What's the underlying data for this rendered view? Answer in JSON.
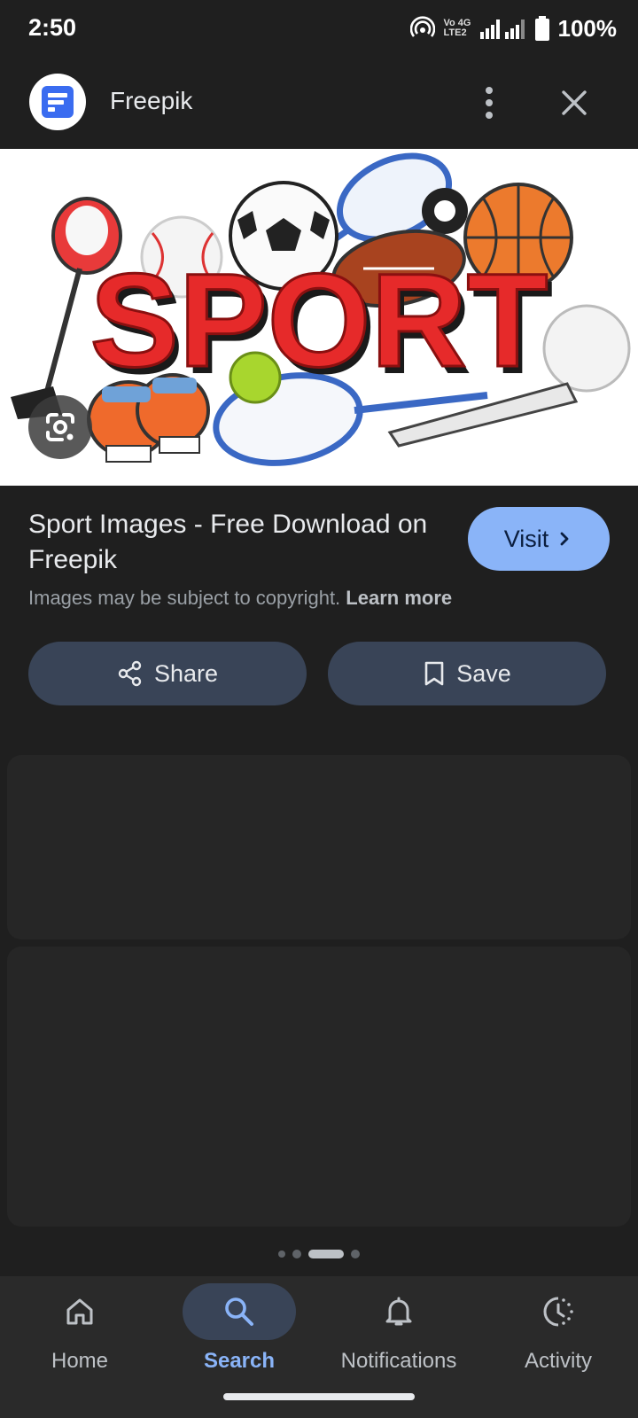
{
  "status_bar": {
    "time": "2:50",
    "network_top": "Vo 4G",
    "network_bottom": "LTE2",
    "battery": "100%"
  },
  "header": {
    "site_name": "Freepik",
    "logo_icon": "freepik-logo-icon",
    "more_icon": "more-vert-icon",
    "close_icon": "close-icon"
  },
  "image": {
    "word": "SPORT",
    "lens_icon": "google-lens-icon"
  },
  "result": {
    "title": "Sport Images - Free Download on Freepik",
    "visit_label": "Visit",
    "copyright_text": "Images may be subject to copyright.",
    "learn_more": "Learn more"
  },
  "actions": {
    "share_label": "Share",
    "save_label": "Save"
  },
  "pager": {
    "count": 4,
    "active_index": 2
  },
  "bottom_nav": {
    "items": [
      {
        "label": "Home",
        "icon": "home-icon",
        "active": false
      },
      {
        "label": "Search",
        "icon": "search-icon",
        "active": true
      },
      {
        "label": "Notifications",
        "icon": "bell-icon",
        "active": false
      },
      {
        "label": "Activity",
        "icon": "activity-icon",
        "active": false
      }
    ]
  },
  "colors": {
    "background": "#1f1f1f",
    "accent": "#8ab4f8",
    "pill": "#394457",
    "sport_red": "#e62a2a"
  }
}
